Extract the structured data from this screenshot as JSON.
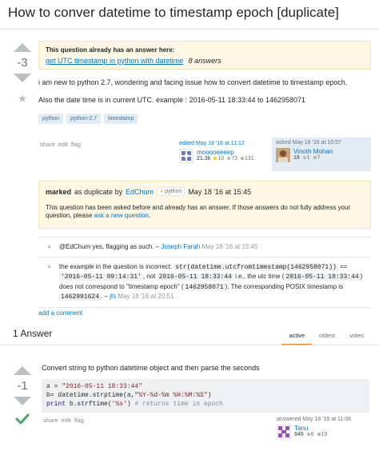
{
  "question": {
    "title": "How to conver datetime to timestamp epoch [duplicate]",
    "score": "-3",
    "notice": {
      "heading": "This question already has an answer here:",
      "link": "get UTC timestamp in python with datetime",
      "count": "8 answers"
    },
    "body": [
      "i am new to python 2.7, wondering and facing issue how to convert datetime to timestamp epoch.",
      "Also the date time is in current UTC. example : 2016-05-11 18:33:44 to 1462958071"
    ],
    "tags": [
      "python",
      "python-2.7",
      "timestamp"
    ],
    "menu": [
      "share",
      "edit",
      "flag"
    ],
    "editor": {
      "action": "edited May 18 '16 at 11:12",
      "name": "mooooeeeep",
      "rep": "21.3k",
      "gold": "10",
      "silver": "73",
      "bronze": "131"
    },
    "owner": {
      "action": "asked May 18 '16 at 10:57",
      "name": "Vinoth Mohan",
      "rep": "19",
      "silver": "1",
      "bronze": "7"
    }
  },
  "marked": {
    "prefix": "marked",
    "middle": "as duplicate by",
    "by": "EdChum",
    "chip": "python",
    "date": "May 18 '16 at 15:45",
    "text1": "This question has been asked before and already has an answer. If those answers do not fully address your",
    "text2": "question, please",
    "link": "ask a new question",
    "text3": "."
  },
  "comments": [
    {
      "text": "@EdChum yes, flagging as such. –",
      "user": "Joseph Farah",
      "date": "May 18 '16 at 15:45"
    },
    {
      "p1": "the example in the question is incorrect:",
      "c1": "str(datetime.utcfromtimestamp(1462958071))",
      "p2": "==",
      "c2": "'2016-05-11 09:14:31'",
      "p3": ", not",
      "c3": "2016-05-11 18:33:44",
      "p4": "i.e., the utc time (",
      "c4": "2016-05-11 18:33:44",
      "p5": ")",
      "p6": "does not correspond to \"timestamp epoch\" (",
      "c5": "1462958071",
      "p7": "). The corresponding POSIX timestamp is",
      "c6": "1462991624",
      "p8": ". –",
      "user": "jfs",
      "date": "May 18 '16 at 20:51"
    }
  ],
  "add_comment": "add a comment",
  "answers": {
    "heading": "1 Answer",
    "tabs": [
      "active",
      "oldest",
      "votes"
    ]
  },
  "answer": {
    "score": "-1",
    "text": "Convert string to python datetime object and then parse the seconds",
    "code": {
      "l1a": "a =",
      "l1s": "\"2016-05-11 18:33:44\"",
      "l2a": "b= datetime.strptime(a,",
      "l2s": "\"%Y-%d-%m %H:%M:%S\"",
      "l2b": ")",
      "l3k": "print",
      "l3a": "b.strftime(",
      "l3s": "'%s'",
      "l3b": ")",
      "l3c": "# returns time in epoch"
    },
    "menu": [
      "share",
      "edit",
      "flag"
    ],
    "author": {
      "action": "answered May 18 '16 at 11:08",
      "name": "Tanu",
      "rep": "945",
      "silver": "6",
      "bronze": "19"
    }
  }
}
